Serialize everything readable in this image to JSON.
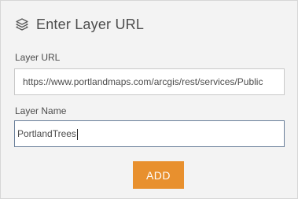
{
  "header": {
    "icon": "layers-icon",
    "title": "Enter Layer URL"
  },
  "form": {
    "url_label": "Layer URL",
    "url_value": "https://www.portlandmaps.com/arcgis/rest/services/Public",
    "name_label": "Layer Name",
    "name_value": "PortlandTrees"
  },
  "actions": {
    "add_label": "ADD"
  },
  "colors": {
    "accent": "#e8902e",
    "panel_background": "#f3f3f3",
    "focused_border": "#6a7f9a"
  }
}
